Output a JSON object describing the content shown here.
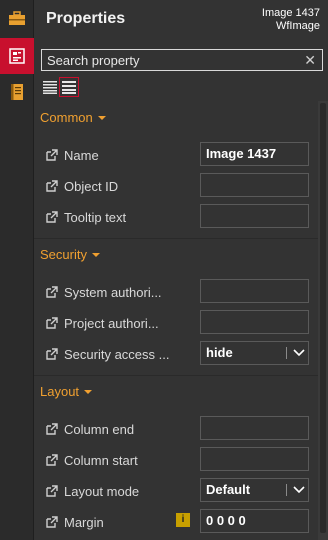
{
  "header": {
    "title": "Properties",
    "object_name": "Image 1437",
    "object_type": "WfImage"
  },
  "search": {
    "placeholder": "Search property",
    "clear_icon": "close-icon"
  },
  "leftbar": {
    "items": [
      "toolbox-icon",
      "properties-icon",
      "document-icon"
    ],
    "active_index": 1,
    "accent": "#c8102e"
  },
  "view_toggles": {
    "items": [
      "list-compact-icon",
      "list-expanded-icon"
    ],
    "selected_index": 1
  },
  "sections": [
    {
      "title": "Common",
      "rows": [
        {
          "label": "Name",
          "value": "Image 1437",
          "type": "text"
        },
        {
          "label": "Object ID",
          "value": "",
          "type": "text"
        },
        {
          "label": "Tooltip text",
          "value": "",
          "type": "text"
        }
      ]
    },
    {
      "title": "Security",
      "rows": [
        {
          "label": "System authori...",
          "value": "",
          "type": "text"
        },
        {
          "label": "Project authori...",
          "value": "",
          "type": "text"
        },
        {
          "label": "Security access ...",
          "value": "hide",
          "type": "select"
        }
      ]
    },
    {
      "title": "Layout",
      "rows": [
        {
          "label": "Column end",
          "value": "",
          "type": "text"
        },
        {
          "label": "Column start",
          "value": "",
          "type": "text"
        },
        {
          "label": "Layout mode",
          "value": "Default",
          "type": "select"
        },
        {
          "label": "Margin",
          "value": "0 0 0 0",
          "type": "text",
          "info_badge": "i"
        }
      ]
    }
  ],
  "colors": {
    "section_title": "#f0a030",
    "background": "#333333",
    "info_badge": "#c8a000"
  }
}
